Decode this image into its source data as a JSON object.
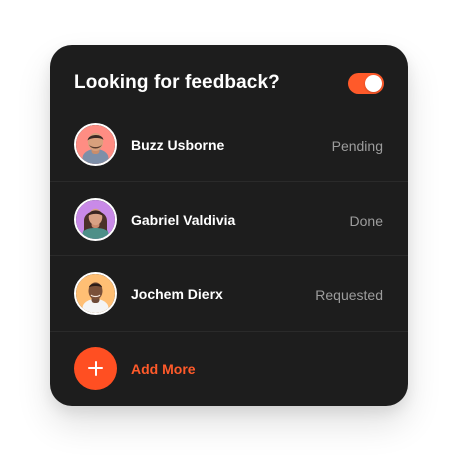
{
  "app": {
    "title": "Looking for feedback?",
    "toggle_on": true,
    "accent_color": "#ff5a2a"
  },
  "people": [
    {
      "name": "Buzz Usborne",
      "status": "Pending",
      "avatar_icon": "man-avatar-icon"
    },
    {
      "name": "Gabriel Valdivia",
      "status": "Done",
      "avatar_icon": "woman-avatar-icon"
    },
    {
      "name": "Jochem Dierx",
      "status": "Requested",
      "avatar_icon": "man-avatar-icon"
    }
  ],
  "actions": {
    "add_more_label": "Add More",
    "add_icon": "plus-icon"
  }
}
